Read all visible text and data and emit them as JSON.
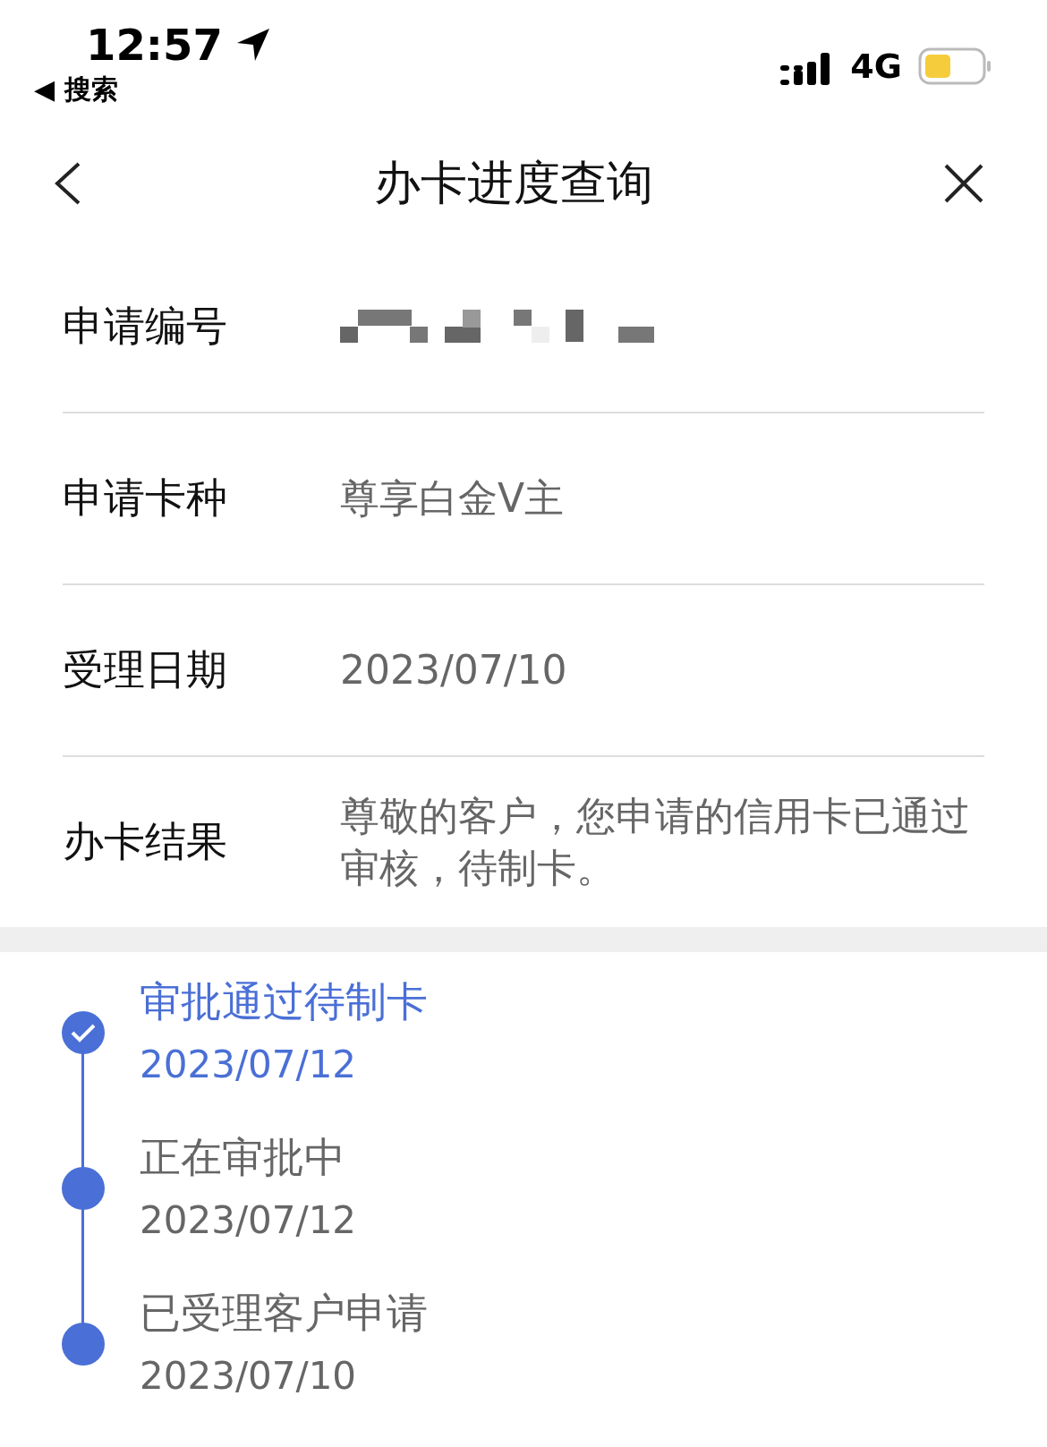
{
  "status_bar": {
    "time": "12:57",
    "back_label": "◀ 搜索",
    "network": "4G"
  },
  "nav": {
    "title": "办卡进度查询"
  },
  "details": [
    {
      "label": "申请编号",
      "kind": "redacted"
    },
    {
      "label": "申请卡种",
      "kind": "text",
      "value": "尊享白金V主"
    },
    {
      "label": "受理日期",
      "kind": "text",
      "value": "2023/07/10"
    },
    {
      "label": "办卡结果",
      "kind": "text",
      "value": "尊敬的客户，您申请的信用卡已通过审核，待制卡。"
    }
  ],
  "timeline": [
    {
      "title": "审批通过待制卡",
      "date": "2023/07/12",
      "current": true
    },
    {
      "title": "正在审批中",
      "date": "2023/07/12",
      "current": false
    },
    {
      "title": "已受理客户申请",
      "date": "2023/07/10",
      "current": false
    }
  ]
}
